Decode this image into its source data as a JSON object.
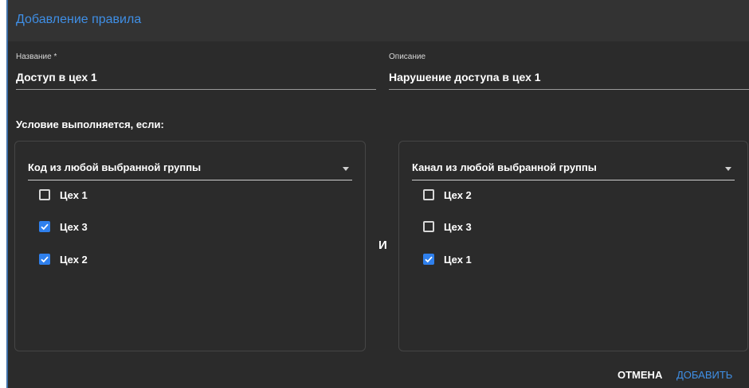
{
  "dialog": {
    "title": "Добавление правила"
  },
  "fields": {
    "name": {
      "label": "Название *",
      "value": "Доступ в цех 1"
    },
    "description": {
      "label": "Описание",
      "value": "Нарушение доступа в цех 1"
    }
  },
  "condition_label": "Условие выполняется, если:",
  "left_panel": {
    "select_value": "Код из любой выбранной группы",
    "items": [
      {
        "label": "Цех 1",
        "checked": false
      },
      {
        "label": "Цех 3",
        "checked": true
      },
      {
        "label": "Цех 2",
        "checked": true
      }
    ]
  },
  "operator": "И",
  "right_panel": {
    "select_value": "Канал из любой выбранной группы",
    "items": [
      {
        "label": "Цех 2",
        "checked": false
      },
      {
        "label": "Цех 3",
        "checked": false
      },
      {
        "label": "Цех 1",
        "checked": true
      }
    ]
  },
  "actions": {
    "cancel": "ОТМЕНА",
    "add": "ДОБАВИТЬ"
  },
  "colors": {
    "accent": "#2f80ed",
    "title": "#3f8fe6",
    "background": "#2b2b2b"
  }
}
